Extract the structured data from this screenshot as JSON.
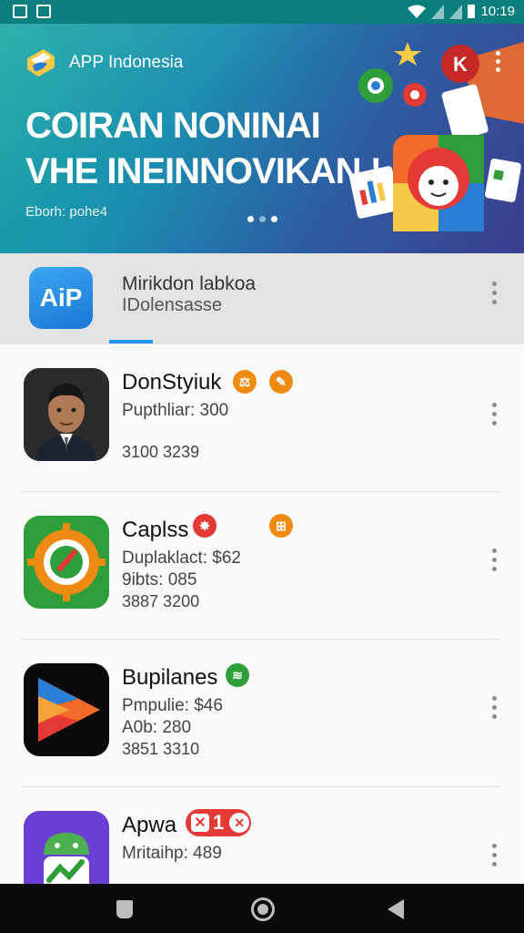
{
  "status_bar": {
    "time": "10:19"
  },
  "banner": {
    "brand": "APP Indonesia",
    "headline_1": "COIRAN NONINAI",
    "headline_2": "VHE INEINNOVIKAN !",
    "subtitle": "Eborh: pohe4",
    "carousel_page": 2,
    "carousel_total": 3
  },
  "header": {
    "logo_text": "AiP",
    "title": "Mirikdon labkoa",
    "subtitle": "IDolensasse"
  },
  "apps": [
    {
      "name": "DonStyiuk",
      "line1": "Pupthliar: 300",
      "line2": "",
      "line3": "3100 3239",
      "badges": [
        {
          "color": "#ef8a12",
          "glyph": "⚖",
          "icon": "scale-badge-icon"
        },
        {
          "color": "#ef8a12",
          "glyph": "✎",
          "icon": "pen-badge-icon"
        }
      ]
    },
    {
      "name": "Caplss",
      "line1": "Duplaklact: $62",
      "line2": "9ibts: 085",
      "line3": "3887 3200",
      "badges": [
        {
          "color": "#e53935",
          "glyph": "✸",
          "icon": "burst-badge-icon"
        },
        {
          "color": "#ef8a12",
          "glyph": "⊞",
          "icon": "grid-badge-icon"
        }
      ]
    },
    {
      "name": "Bupilanes",
      "line1": "Pmpulie: $46",
      "line2": "A0b: 280",
      "line3": "3851 3310",
      "badges": [
        {
          "color": "#2e9e3a",
          "glyph": "≋",
          "icon": "stack-badge-icon"
        }
      ]
    },
    {
      "name": "Apwa",
      "line1": "Mritaihp: 489",
      "line2": "",
      "line3": "",
      "badges": [
        {
          "color": "#e53935",
          "glyph": "✕",
          "icon": "close-badge-icon"
        }
      ]
    }
  ],
  "colors": {
    "status_bar": "#0b7f7e",
    "accent": "#2196f3",
    "navbar": "#0a0a0a"
  }
}
